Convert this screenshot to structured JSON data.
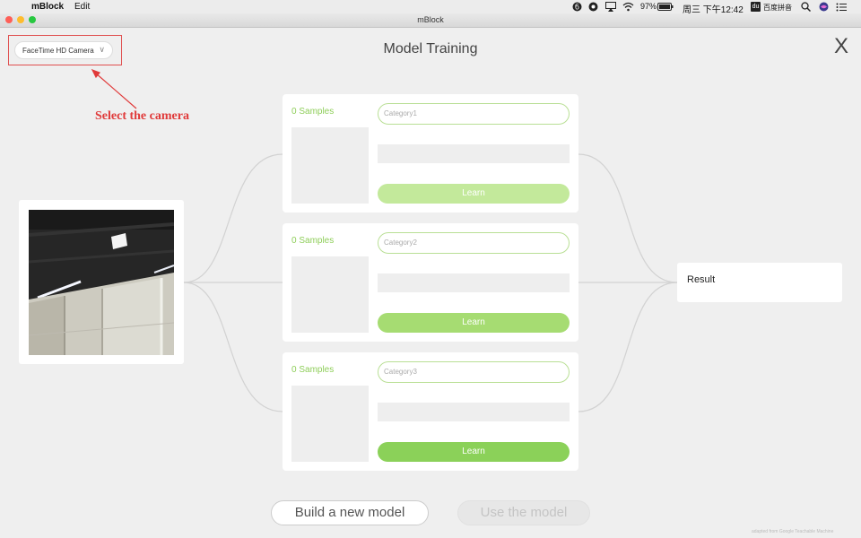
{
  "menubar": {
    "apple_glyph": "",
    "app_name": "mBlock",
    "menu_edit": "Edit",
    "battery": "97%",
    "clock": "周三 下午12:42",
    "input_method_badge": "du",
    "input_method": "百度拼音",
    "icons": [
      "apple-icon",
      "creative-cloud-icon",
      "app-icon",
      "airplay-icon",
      "wifi-icon",
      "battery-icon",
      "search-icon",
      "siri-icon",
      "menu-list-icon"
    ]
  },
  "window": {
    "title": "mBlock",
    "traffic_lights": {
      "close": "#fe5f57",
      "minimize": "#febc2e",
      "zoom": "#28c840"
    }
  },
  "camera": {
    "selected": "FaceTime HD Camera"
  },
  "annotation": {
    "text": "Select the camera",
    "color": "#e03a3a"
  },
  "page": {
    "title": "Model Training",
    "close_glyph": "X"
  },
  "categories": [
    {
      "samples": "0 Samples",
      "placeholder": "Category1",
      "learn_label": "Learn",
      "learn_color": "#c3e99b"
    },
    {
      "samples": "0 Samples",
      "placeholder": "Category2",
      "learn_label": "Learn",
      "learn_color": "#a6dc72"
    },
    {
      "samples": "0 Samples",
      "placeholder": "Category3",
      "learn_label": "Learn",
      "learn_color": "#8bd159"
    }
  ],
  "result": {
    "label": "Result"
  },
  "actions": {
    "build_label": "Build a new model",
    "use_label": "Use the model"
  },
  "credit": "adapted from Google Teachable Machine",
  "colors": {
    "accent_green": "#8fce5a",
    "highlight_red": "#e05050"
  }
}
